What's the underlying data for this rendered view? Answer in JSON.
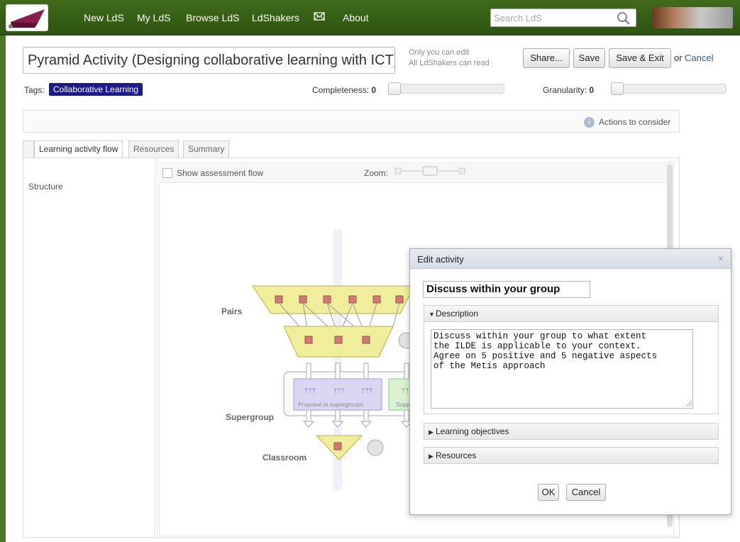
{
  "nav": {
    "items": [
      "New LdS",
      "My LdS",
      "Browse LdS",
      "LdShakers",
      "About"
    ],
    "mail_icon": "envelope-icon",
    "search_placeholder": "Search LdS"
  },
  "design": {
    "title": "Pyramid Activity (Designing collaborative learning with ICT)",
    "permission_line1": "Only you can edit",
    "permission_line2": "All LdShakers can read",
    "buttons": {
      "share": "Share...",
      "save": "Save",
      "save_exit": "Save & Exit",
      "or": "or",
      "cancel": "Cancel"
    },
    "tags_label": "Tags:",
    "tag": "Collaborative Learning",
    "completeness_label": "Completeness:",
    "completeness_value": "0",
    "granularity_label": "Granularity:",
    "granularity_value": "0",
    "actions_label": "Actions to consider"
  },
  "tabs": [
    "Learning activity flow",
    "Resources",
    "Summary"
  ],
  "left_pane": {
    "structure_label": "Structure"
  },
  "canvas": {
    "show_assessment_label": "Show assessment flow",
    "zoom_label": "Zoom:",
    "levels": {
      "pairs": "Pairs",
      "supergroup": "Supergroup",
      "classroom": "Classroom"
    },
    "box_label_1": "Proposal in supergroups",
    "box_label_2": "Supp"
  },
  "dialog": {
    "title": "Edit activity",
    "close": "×",
    "activity_name": "Discuss within your group",
    "description_label": "Description",
    "description_text": "Discuss within your group to what extent\nthe ILDE is applicable to your context.\nAgree on 5 positive and 5 negative aspects\nof the Metis approach",
    "objectives_label": "Learning objectives",
    "resources_label": "Resources",
    "ok": "OK",
    "cancel": "Cancel"
  },
  "colors": {
    "topbar": "#3f6b1a",
    "tag_bg": "#1a1a8c",
    "trapezoid_fill": "#f0ee9a",
    "node_fill": "#cf7a74",
    "purple_box": "#dcd6f5",
    "green_box": "#d9f1d3"
  }
}
